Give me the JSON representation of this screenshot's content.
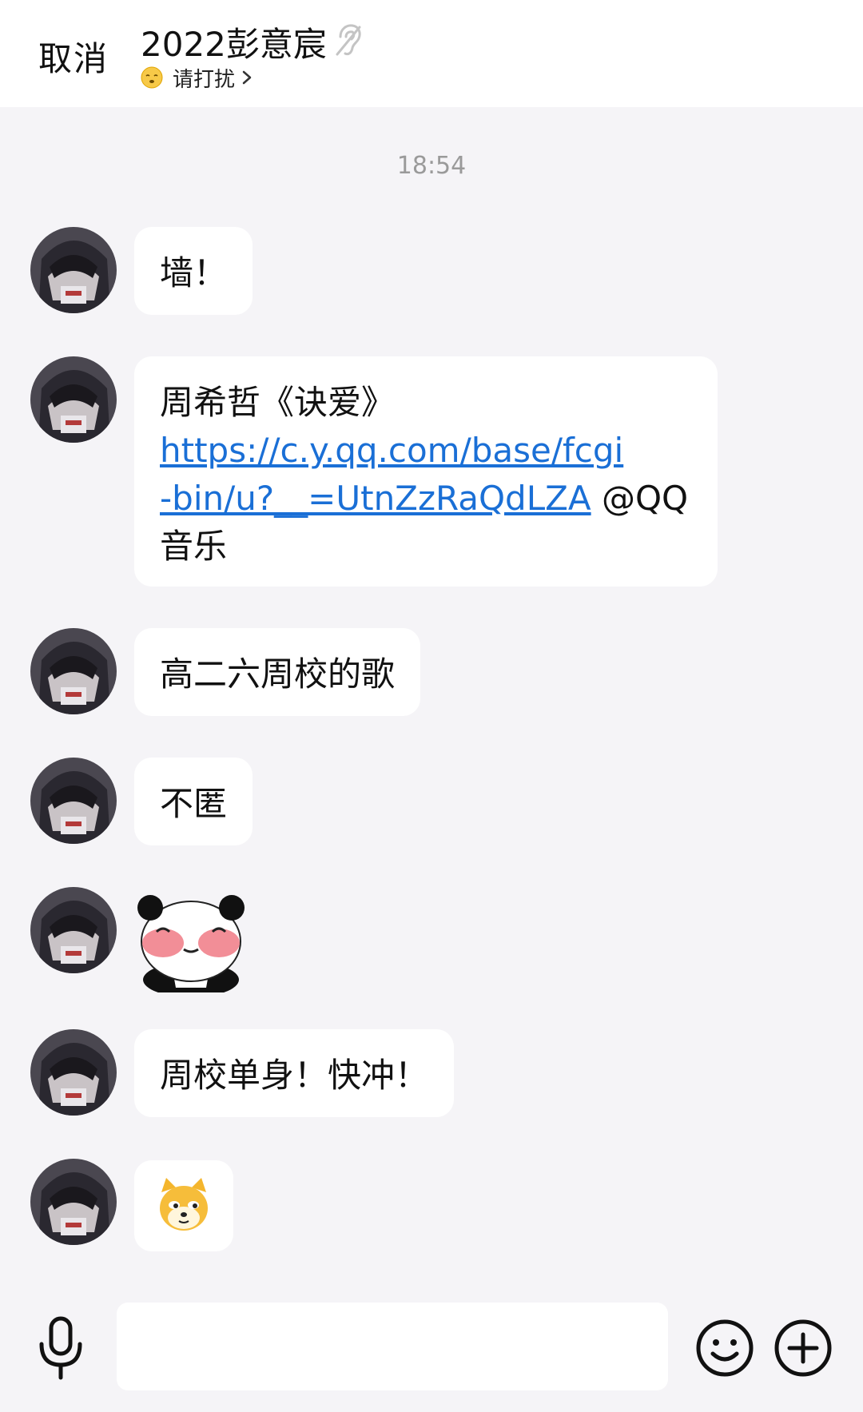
{
  "header": {
    "cancel_label": "取消",
    "title": "2022彭意宸",
    "status_text": "请打扰"
  },
  "timestamp": "18:54",
  "messages": [
    {
      "type": "text",
      "text": "墙！"
    },
    {
      "type": "link",
      "prefix": "周希哲《诀爱》",
      "url_line1": "https://c.y.qq.com/base/fcgi",
      "url_line2": "-bin/u?__=UtnZzRaQdLZA",
      "suffix": " @QQ",
      "suffix2": "音乐"
    },
    {
      "type": "text",
      "text": "高二六周校的歌"
    },
    {
      "type": "text",
      "text": "不匿"
    },
    {
      "type": "sticker",
      "icon": "blushing-panda-sticker"
    },
    {
      "type": "text",
      "text": "周校单身！快冲！"
    },
    {
      "type": "emoji",
      "icon": "dog-face-emoji"
    }
  ],
  "colors": {
    "background": "#f5f4f7",
    "bubble": "#ffffff",
    "link": "#1a6fd6"
  }
}
